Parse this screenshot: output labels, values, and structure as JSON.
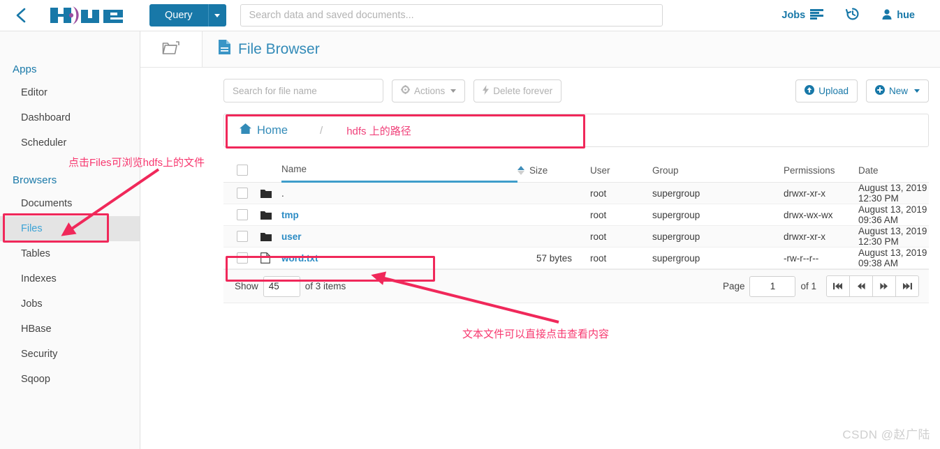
{
  "topbar": {
    "back_icon": "chevron-left-icon",
    "logo_text": "hue",
    "query_label": "Query",
    "search_placeholder": "Search data and saved documents...",
    "search_value": "",
    "jobs_label": "Jobs",
    "history_icon": "history-icon",
    "user_label": "hue",
    "accent_color": "#1878a8"
  },
  "sidebar": {
    "groups": [
      {
        "label": "Apps",
        "items": [
          {
            "label": "Editor",
            "active": false
          },
          {
            "label": "Dashboard",
            "active": false
          },
          {
            "label": "Scheduler",
            "active": false
          }
        ]
      },
      {
        "label": "Browsers",
        "items": [
          {
            "label": "Documents",
            "active": false
          },
          {
            "label": "Files",
            "active": true
          },
          {
            "label": "Tables",
            "active": false
          },
          {
            "label": "Indexes",
            "active": false
          },
          {
            "label": "Jobs",
            "active": false
          },
          {
            "label": "HBase",
            "active": false
          },
          {
            "label": "Security",
            "active": false
          },
          {
            "label": "Sqoop",
            "active": false
          }
        ]
      }
    ]
  },
  "app_header": {
    "assist_icon": "folder-icon",
    "title_icon": "file-doc-icon",
    "title": "File Browser"
  },
  "toolbar": {
    "search_placeholder": "Search for file name",
    "search_value": "",
    "actions_label": "Actions",
    "actions_icon": "gear-icon",
    "delete_label": "Delete forever",
    "delete_icon": "bolt-icon",
    "upload_label": "Upload",
    "upload_icon": "upload-circle-icon",
    "new_label": "New",
    "new_icon": "plus-circle-icon"
  },
  "breadcrumb": {
    "home_icon": "home-icon",
    "home_label": "Home",
    "separator": "/",
    "annotation": "hdfs 上的路径"
  },
  "table": {
    "columns": [
      "Name",
      "Size",
      "User",
      "Group",
      "Permissions",
      "Date"
    ],
    "sorted_column": "Name",
    "sort_direction": "asc",
    "rows": [
      {
        "icon": "folder-icon",
        "name": ".",
        "size": "",
        "user": "root",
        "group": "supergroup",
        "permissions": "drwxr-xr-x",
        "date": "August 13, 2019 12:30 PM"
      },
      {
        "icon": "folder-icon",
        "name": "tmp",
        "size": "",
        "user": "root",
        "group": "supergroup",
        "permissions": "drwx-wx-wx",
        "date": "August 13, 2019 09:36 AM"
      },
      {
        "icon": "folder-icon",
        "name": "user",
        "size": "",
        "user": "root",
        "group": "supergroup",
        "permissions": "drwxr-xr-x",
        "date": "August 13, 2019 12:30 PM"
      },
      {
        "icon": "file-icon",
        "name": "word.txt",
        "size": "57 bytes",
        "user": "root",
        "group": "supergroup",
        "permissions": "-rw-r--r--",
        "date": "August 13, 2019 09:38 AM"
      }
    ]
  },
  "pagination": {
    "show_label": "Show",
    "page_size": "45",
    "of_items_label": "of 3 items",
    "page_label": "Page",
    "page_value": "1",
    "of_pages_label": "of 1",
    "first_icon": "first-page-icon",
    "prev_icon": "prev-page-icon",
    "next_icon": "next-page-icon",
    "last_icon": "last-page-icon"
  },
  "annotations": {
    "color": "#f0285a",
    "sidebar_note": "点击Files可浏览hdfs上的文件",
    "file_note": "文本文件可以直接点击查看内容"
  },
  "watermark": {
    "text": "CSDN @赵广陆"
  }
}
